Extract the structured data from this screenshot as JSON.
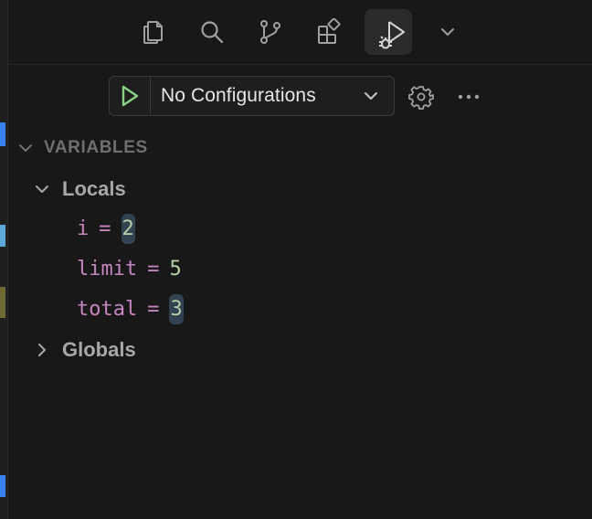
{
  "activity_bar": {
    "icons": [
      {
        "name": "explorer-icon"
      },
      {
        "name": "search-icon"
      },
      {
        "name": "source-control-icon"
      },
      {
        "name": "extensions-icon"
      },
      {
        "name": "run-and-debug-icon",
        "active": true
      },
      {
        "name": "chevron-down-icon"
      }
    ]
  },
  "debug_toolbar": {
    "configuration": "No Configurations",
    "start_icon_color": "#89d185"
  },
  "variables": {
    "section_title": "VARIABLES",
    "scopes": [
      {
        "label": "Locals",
        "expanded": true,
        "items": [
          {
            "name": "i",
            "eq": "=",
            "value": "2",
            "changed": true
          },
          {
            "name": "limit",
            "eq": "=",
            "value": "5",
            "changed": false
          },
          {
            "name": "total",
            "eq": "=",
            "value": "3",
            "changed": true
          }
        ]
      },
      {
        "label": "Globals",
        "expanded": false
      }
    ]
  },
  "colors": {
    "background": "#181818",
    "variable_name": "#c586c0",
    "variable_value": "#b5cea8",
    "changed_highlight": "#324250"
  }
}
